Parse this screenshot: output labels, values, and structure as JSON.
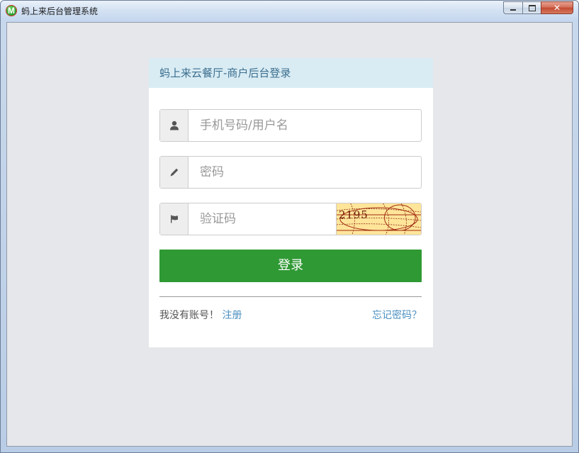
{
  "window": {
    "title": "蚂上来后台管理系统",
    "app_icon_letter": "M",
    "close_symbol": "✕"
  },
  "login": {
    "header": "蚂上来云餐厅-商户后台登录",
    "username_placeholder": "手机号码/用户名",
    "password_placeholder": "密码",
    "captcha_placeholder": "验证码",
    "captcha_text": "2195",
    "login_button": "登录",
    "no_account_text": "我没有账号！",
    "register_link": "注册",
    "forgot_password_link": "忘记密码？"
  },
  "icons": {
    "username": "user-icon",
    "password": "pencil-icon",
    "captcha": "flag-icon"
  },
  "colors": {
    "header_bg": "#d9ecf4",
    "header_text": "#3b6e8e",
    "login_button": "#2f9934",
    "link": "#4b8fc0",
    "client_bg": "#e6e7ea"
  }
}
